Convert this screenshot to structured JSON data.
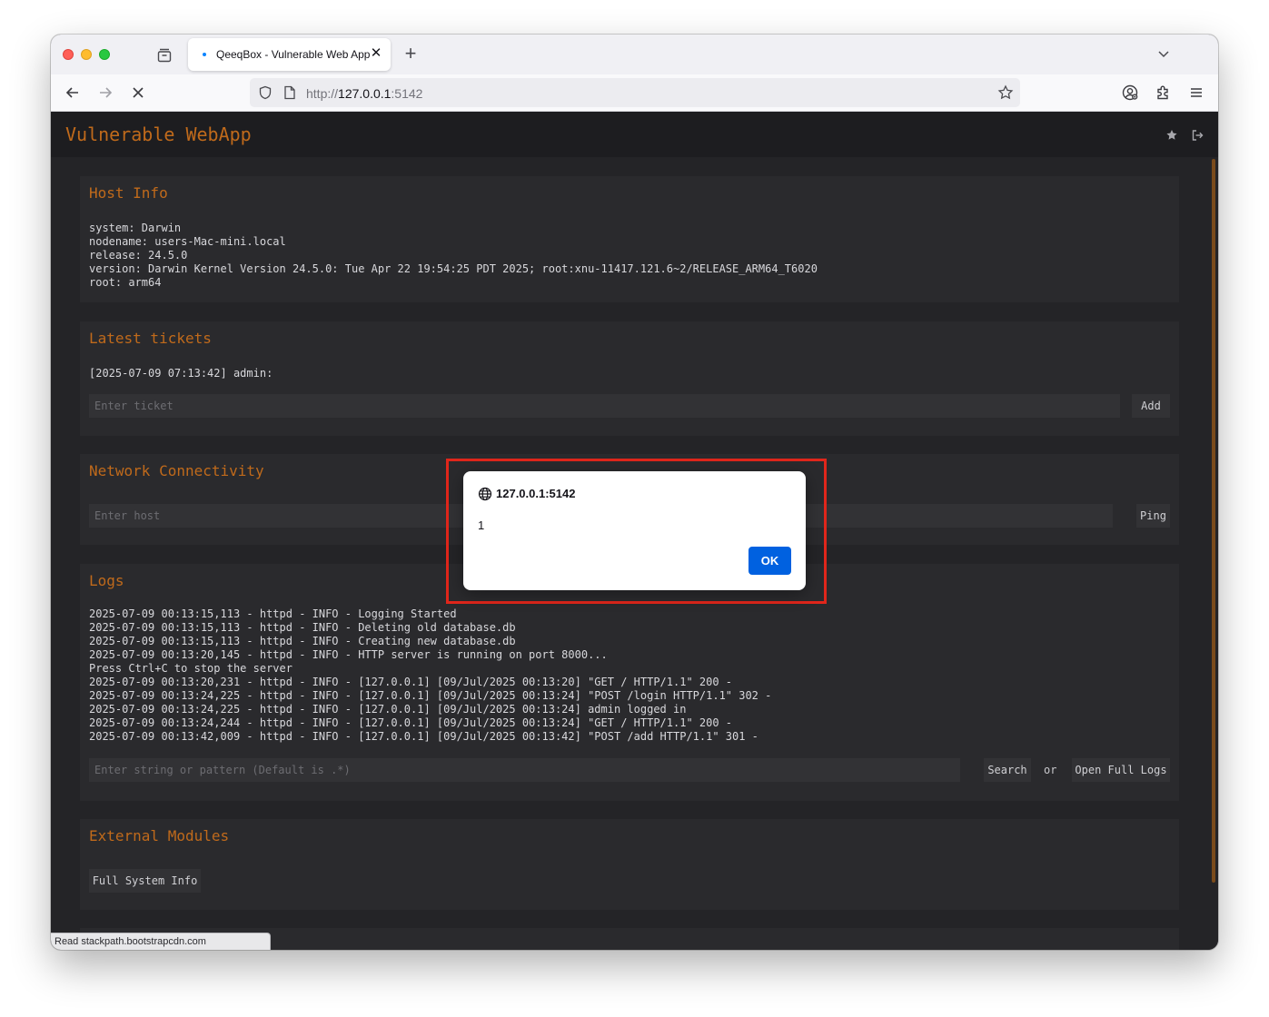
{
  "browser": {
    "tab_title": "QeeqBox - Vulnerable Web App",
    "tab_close": "✕",
    "new_tab": "+",
    "url_prefix": "http://",
    "url_host": "127.0.0.1",
    "url_port": ":5142"
  },
  "app": {
    "brand": "Vulnerable WebApp",
    "host_info": {
      "title": "Host Info",
      "lines": [
        "system: Darwin",
        "nodename: users-Mac-mini.local",
        "release: 24.5.0",
        "version: Darwin Kernel Version 24.5.0: Tue Apr 22 19:54:25 PDT 2025; root:xnu-11417.121.6~2/RELEASE_ARM64_T6020",
        "root: arm64"
      ]
    },
    "tickets": {
      "title": "Latest tickets",
      "entry": "[2025-07-09 07:13:42] admin:",
      "input_placeholder": "Enter ticket",
      "add_label": "Add"
    },
    "network": {
      "title": "Network Connectivity",
      "input_placeholder": "Enter host",
      "ping_label": "Ping"
    },
    "logs": {
      "title": "Logs",
      "lines": [
        "2025-07-09 00:13:15,113 - httpd - INFO - Logging Started",
        "2025-07-09 00:13:15,113 - httpd - INFO - Deleting old database.db",
        "2025-07-09 00:13:15,113 - httpd - INFO - Creating new database.db",
        "2025-07-09 00:13:20,145 - httpd - INFO - HTTP server is running on port 8000...",
        "Press Ctrl+C to stop the server",
        "2025-07-09 00:13:20,231 - httpd - INFO - [127.0.0.1] [09/Jul/2025 00:13:20] \"GET / HTTP/1.1\" 200 -",
        "2025-07-09 00:13:24,225 - httpd - INFO - [127.0.0.1] [09/Jul/2025 00:13:24] \"POST /login HTTP/1.1\" 302 -",
        "2025-07-09 00:13:24,225 - httpd - INFO - [127.0.0.1] [09/Jul/2025 00:13:24] admin logged in",
        "2025-07-09 00:13:24,244 - httpd - INFO - [127.0.0.1] [09/Jul/2025 00:13:24] \"GET / HTTP/1.1\" 200 -",
        "2025-07-09 00:13:42,009 - httpd - INFO - [127.0.0.1] [09/Jul/2025 00:13:42] \"POST /add HTTP/1.1\" 301 -"
      ],
      "search_placeholder": "Enter string or pattern (Default is .*)",
      "search_label": "Search",
      "or_label": "or",
      "open_full_label": "Open Full Logs"
    },
    "modules": {
      "title": "External Modules",
      "full_system_label": "Full System Info"
    }
  },
  "status_bar": "Read stackpath.bootstrapcdn.com",
  "alert": {
    "origin": "127.0.0.1:5142",
    "message": "1",
    "ok_label": "OK"
  },
  "colors": {
    "accent": "#c06a1b",
    "page_bg": "#242427",
    "card_bg": "#2a2a2d",
    "alert_button": "#0061e0",
    "highlight": "#e0261b"
  },
  "icons": [
    "tab-overview-icon",
    "back-icon",
    "forward-icon",
    "stop-loading-icon",
    "shield-icon",
    "page-icon",
    "bookmark-star-icon",
    "account-icon",
    "extensions-icon",
    "menu-icon",
    "tab-list-chevron-icon",
    "favorite-star-icon",
    "logout-icon",
    "globe-icon"
  ]
}
